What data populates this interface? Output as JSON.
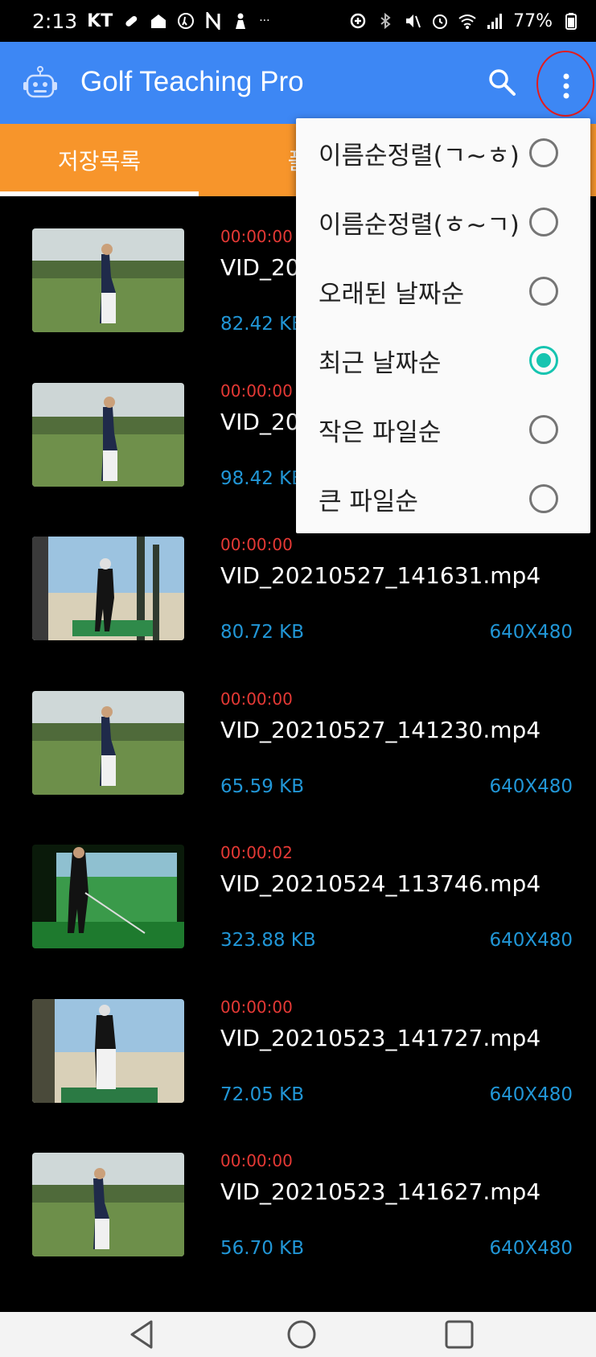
{
  "status_bar": {
    "time": "2:13",
    "carrier": "KT",
    "battery": "77%",
    "more_indicator": "···"
  },
  "app_bar": {
    "title": "Golf Teaching Pro",
    "icons": [
      "robot-icon",
      "search-icon",
      "more-vert-icon"
    ]
  },
  "tabs": [
    {
      "label": "저장목록",
      "active": true
    },
    {
      "label": "폴",
      "active": false
    }
  ],
  "sort_menu": {
    "items": [
      {
        "label": "이름순정렬(ㄱ~ㅎ)",
        "selected": false
      },
      {
        "label": "이름순정렬(ㅎ~ㄱ)",
        "selected": false
      },
      {
        "label": "오래된 날짜순",
        "selected": false
      },
      {
        "label": "최근 날짜순",
        "selected": true
      },
      {
        "label": "작은 파일순",
        "selected": false
      },
      {
        "label": "큰 파일순",
        "selected": false
      }
    ]
  },
  "videos": [
    {
      "duration": "00:00:00",
      "filename": "VID_20",
      "size": "82.42 KB",
      "resolution": "",
      "thumb": "golf-course"
    },
    {
      "duration": "00:00:00",
      "filename": "VID_20",
      "size": "98.42 KB",
      "resolution": "",
      "thumb": "golf-course"
    },
    {
      "duration": "00:00:00",
      "filename": "VID_20210527_141631.mp4",
      "size": "80.72 KB",
      "resolution": "640X480",
      "thumb": "driving-range"
    },
    {
      "duration": "00:00:00",
      "filename": "VID_20210527_141230.mp4",
      "size": "65.59 KB",
      "resolution": "640X480",
      "thumb": "golf-course"
    },
    {
      "duration": "00:00:02",
      "filename": "VID_20210524_113746.mp4",
      "size": "323.88 KB",
      "resolution": "640X480",
      "thumb": "simulator"
    },
    {
      "duration": "00:00:00",
      "filename": "VID_20210523_141727.mp4",
      "size": "72.05 KB",
      "resolution": "640X480",
      "thumb": "driving-range"
    },
    {
      "duration": "00:00:00",
      "filename": "VID_20210523_141627.mp4",
      "size": "56.70 KB",
      "resolution": "640X480",
      "thumb": "golf-course"
    }
  ],
  "colors": {
    "app_bar": "#3d87f4",
    "tab_bar": "#f7952b",
    "duration": "#e53935",
    "meta": "#2196d6",
    "radio_checked": "#16c4b0",
    "highlight_circle": "#e41b1b"
  }
}
